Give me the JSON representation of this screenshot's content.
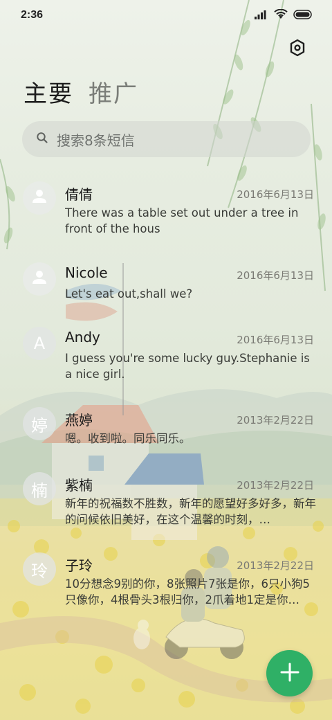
{
  "status_bar": {
    "time": "2:36",
    "icons": [
      "signal-icon",
      "wifi-icon",
      "battery-icon"
    ]
  },
  "header": {
    "settings_icon": "gear-icon",
    "tabs": [
      {
        "label": "主要",
        "active": true
      },
      {
        "label": "推广",
        "active": false
      }
    ]
  },
  "search": {
    "icon": "search-icon",
    "placeholder": "搜索8条短信"
  },
  "messages": [
    {
      "avatar_type": "person-icon",
      "avatar_text": "",
      "name": "倩倩",
      "date": "2016年6月13日",
      "preview": "There was a table set out under a tree in front of the hous"
    },
    {
      "avatar_type": "person-icon",
      "avatar_text": "",
      "name": "Nicole",
      "date": "2016年6月13日",
      "preview": "Let's eat out,shall we?"
    },
    {
      "avatar_type": "letter",
      "avatar_text": "A",
      "name": "Andy",
      "date": "2016年6月13日",
      "preview": "I guess you're some lucky guy.Stephanie is a nice girl."
    },
    {
      "avatar_type": "letter",
      "avatar_text": "婷",
      "name": "燕婷",
      "date": "2013年2月22日",
      "preview": "嗯。收到啦。同乐同乐。"
    },
    {
      "avatar_type": "letter",
      "avatar_text": "楠",
      "name": "紫楠",
      "date": "2013年2月22日",
      "preview": "新年的祝福数不胜数，新年的愿望好多好多，新年的问候依旧美好，在这个温馨的时刻，…"
    },
    {
      "avatar_type": "letter",
      "avatar_text": "玲",
      "name": "子玲",
      "date": "2013年2月22日",
      "preview": "10分想念9别的你，8张照片7张是你，6只小狗5只像你，4根骨头3根归你，2爪着地1定是你…"
    }
  ],
  "fab": {
    "icon": "plus-icon",
    "color": "#2fb066"
  },
  "colors": {
    "accent": "#2fb066",
    "text_primary": "#1a1a1a",
    "text_secondary": "#7a7a74"
  }
}
